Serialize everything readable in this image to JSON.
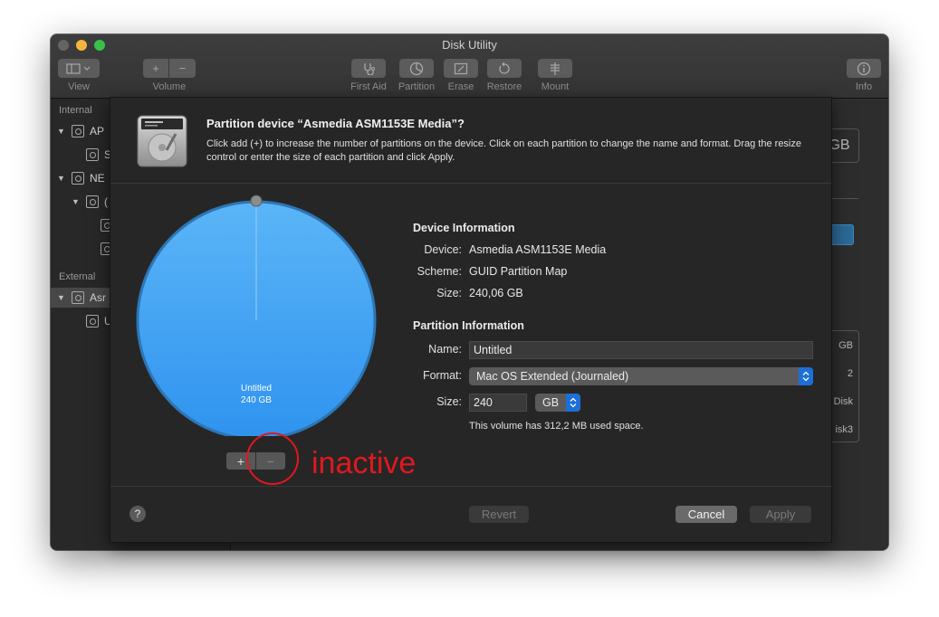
{
  "window": {
    "title": "Disk Utility"
  },
  "toolbar": {
    "view_label": "View",
    "volume_label": "Volume",
    "volume_add": "+",
    "volume_remove": "−",
    "first_aid_label": "First Aid",
    "partition_label": "Partition",
    "erase_label": "Erase",
    "restore_label": "Restore",
    "mount_label": "Mount",
    "info_label": "Info"
  },
  "sidebar": {
    "internal_header": "Internal",
    "external_header": "External",
    "items": [
      {
        "label": "AP",
        "level": 0,
        "disclosure": "▼"
      },
      {
        "label": "S",
        "level": 1,
        "disclosure": ""
      },
      {
        "label": "NE",
        "level": 0,
        "disclosure": "▼"
      },
      {
        "label": "(",
        "level": 1,
        "disclosure": "▼"
      },
      {
        "label": "",
        "level": 2,
        "disclosure": ""
      },
      {
        "label": "",
        "level": 2,
        "disclosure": ""
      },
      {
        "label": "Asr",
        "level": 0,
        "disclosure": "▼"
      },
      {
        "label": "U",
        "level": 1,
        "disclosure": ""
      }
    ]
  },
  "background_panel": {
    "capacity_fragment": "GB",
    "table_values": [
      "GB",
      "2",
      "Disk",
      "isk3"
    ]
  },
  "dialog": {
    "title": "Partition device “Asmedia ASM1153E Media”?",
    "description": "Click add (+) to increase the number of partitions on the device. Click on each partition to change the name and format. Drag the resize control or enter the size of each partition and click Apply.",
    "pie": {
      "partition_name": "Untitled",
      "partition_size": "240 GB",
      "fill_fraction": 1.0
    },
    "add_button": "+",
    "remove_button": "−",
    "device_info": {
      "header": "Device Information",
      "device_label": "Device:",
      "device_value": "Asmedia ASM1153E Media",
      "scheme_label": "Scheme:",
      "scheme_value": "GUID Partition Map",
      "size_label": "Size:",
      "size_value": "240,06 GB"
    },
    "partition_info": {
      "header": "Partition Information",
      "name_label": "Name:",
      "name_value": "Untitled",
      "format_label": "Format:",
      "format_value": "Mac OS Extended (Journaled)",
      "size_label": "Size:",
      "size_value": "240",
      "size_unit": "GB",
      "note": "This volume has 312,2 MB used space."
    },
    "help_button": "?",
    "revert_button": "Revert",
    "cancel_button": "Cancel",
    "apply_button": "Apply"
  },
  "annotation": {
    "text": "inactive",
    "color": "#e1181e"
  },
  "colors": {
    "pie_fill": "#4aa8f5",
    "accent": "#1c6fd6"
  }
}
